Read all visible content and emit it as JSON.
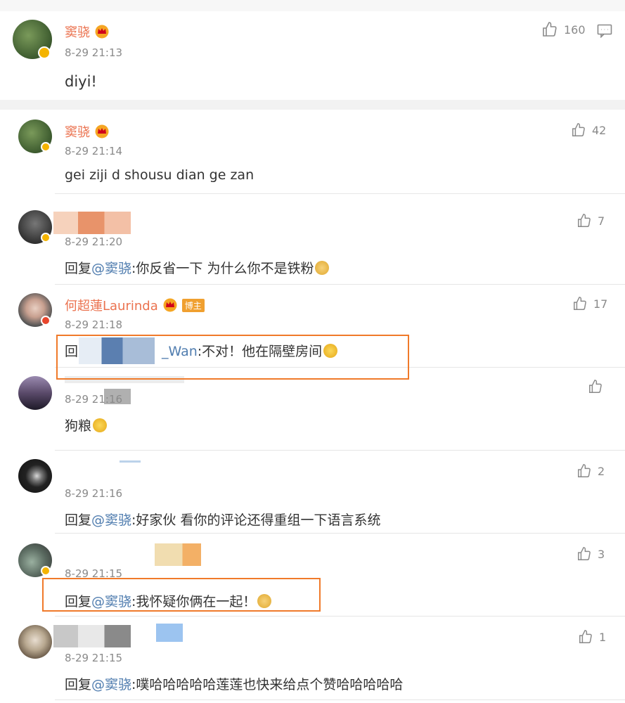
{
  "top": {
    "name": "窦骁",
    "time": "8-29 21:13",
    "text": "diyi!",
    "likes": "160"
  },
  "comments": [
    {
      "name": "窦骁",
      "time": "8-29 21:14",
      "text": "gei ziji d shousu dian ge zan",
      "likes": "42"
    },
    {
      "name": "",
      "time": "8-29 21:20",
      "reply_prefix": "回复",
      "mention": "@窦骁",
      "text": ":你反省一下 为什么你不是铁粉",
      "likes": "7"
    },
    {
      "name": "何超蓮Laurinda",
      "host_tag": "博主",
      "time": "8-29 21:18",
      "reply_prefix": "回复",
      "mention": "_Wan",
      "text": ":不对！他在隔壁房间",
      "likes": "17"
    },
    {
      "name": "",
      "time": "8-29 21:16",
      "text": "狗粮",
      "likes": ""
    },
    {
      "name": "",
      "time": "8-29 21:16",
      "reply_prefix": "回复",
      "mention": "@窦骁",
      "text": ":好家伙 看你的评论还得重组一下语言系统",
      "likes": "2"
    },
    {
      "name": "",
      "time": "8-29 21:15",
      "reply_prefix": "回复",
      "mention": "@窦骁",
      "text": ":我怀疑你俩在一起！",
      "likes": "3"
    },
    {
      "name": "",
      "time": "8-29 21:15",
      "reply_prefix": "回复",
      "mention": "@窦骁",
      "text": ":噗哈哈哈哈哈莲莲也快来给点个赞哈哈哈哈哈",
      "likes": "1"
    }
  ],
  "icons": {
    "like": "thumbs-up-icon",
    "reply": "comment-bubble-icon",
    "crown": "crown-badge-icon",
    "verified": "verified-badge-icon"
  },
  "colors": {
    "name": "#eb7350",
    "mention": "#507daf",
    "highlight_box": "#f07a2a",
    "verified_gold": "#f4b400",
    "verified_red": "#e8452c"
  }
}
